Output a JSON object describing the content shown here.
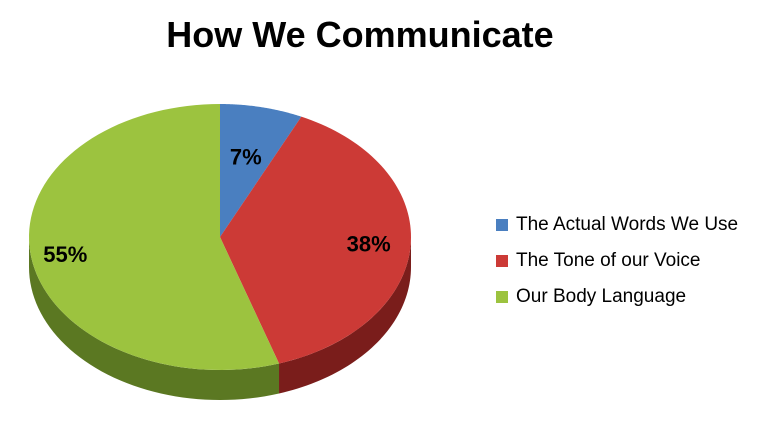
{
  "chart_data": {
    "type": "pie",
    "title": "How We Communicate",
    "categories": [
      "The Actual Words We Use",
      "The Tone of our Voice",
      "Our Body Language"
    ],
    "values": [
      7,
      38,
      55
    ],
    "labels": [
      "7%",
      "38%",
      "55%"
    ],
    "colors": [
      "#4a7fc0",
      "#cc3a36",
      "#9cc33f"
    ],
    "side_colors": [
      "#2b4e7c",
      "#7a1d1b",
      "#5b7822"
    ],
    "legend_placement": "right",
    "style": "3d"
  }
}
